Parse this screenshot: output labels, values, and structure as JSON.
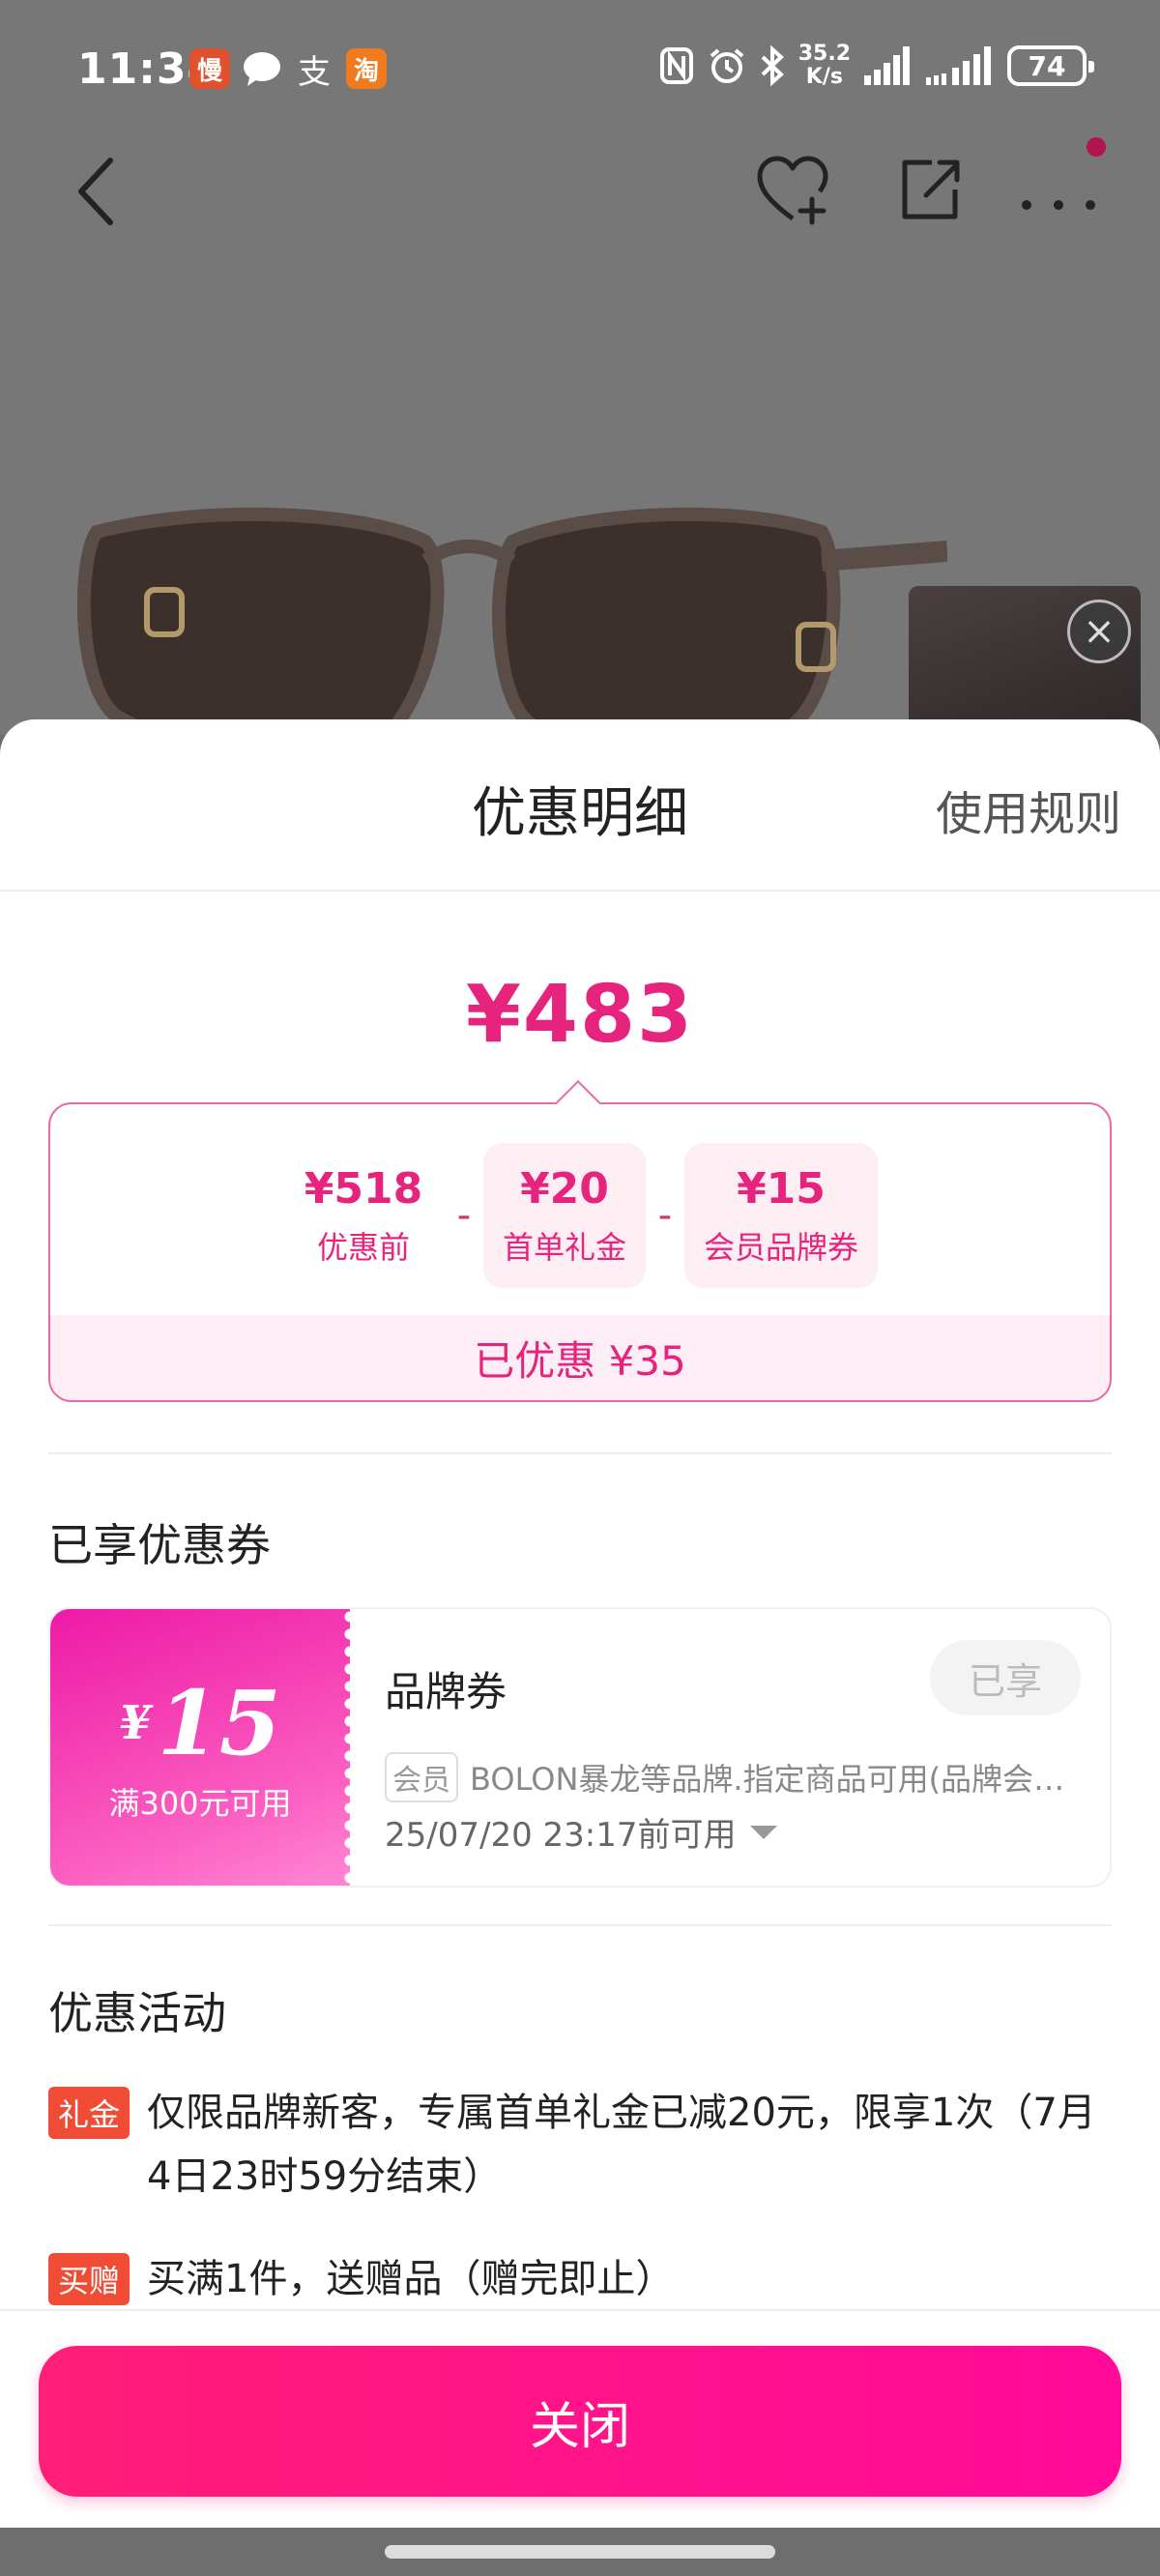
{
  "status_bar": {
    "time": "11:34",
    "net_speed_value": "35.2",
    "net_speed_unit": "K/s",
    "battery": "74",
    "app_icons": [
      "慢",
      "chat-bubble-icon",
      "支",
      "淘"
    ]
  },
  "nav": {
    "back_icon": "back-chevron-icon",
    "favorite_icon": "heart-plus-icon",
    "share_icon": "share-icon",
    "more_icon": "more-dots-icon"
  },
  "sheet": {
    "title": "优惠明细",
    "rules_link": "使用规则"
  },
  "price": {
    "final": "¥483",
    "breakdown": [
      {
        "value": "¥518",
        "label": "优惠前"
      },
      {
        "value": "¥20",
        "label": "首单礼金"
      },
      {
        "value": "¥15",
        "label": "会员品牌券"
      }
    ],
    "operator": "-",
    "saved": "已优惠 ¥35"
  },
  "coupons": {
    "section_title": "已享优惠券",
    "items": [
      {
        "currency": "¥",
        "amount": "15",
        "condition": "满300元可用",
        "name": "品牌券",
        "status": "已享",
        "tag": "会员",
        "description": "BOLON暴龙等品牌.指定商品可用(品牌会员专享)",
        "valid_until": "25/07/20 23:17前可用"
      }
    ]
  },
  "promotions": {
    "section_title": "优惠活动",
    "items": [
      {
        "tag": "礼金",
        "text": "仅限品牌新客，专属首单礼金已减20元，限享1次（7月4日23时59分结束）"
      },
      {
        "tag": "买赠",
        "text": "买满1件，送赠品（赠完即止）"
      }
    ]
  },
  "footer": {
    "close_label": "关闭"
  },
  "colors": {
    "accent": "#e6247d",
    "button": "#ff1e78",
    "promo_tag": "#f04b35"
  }
}
